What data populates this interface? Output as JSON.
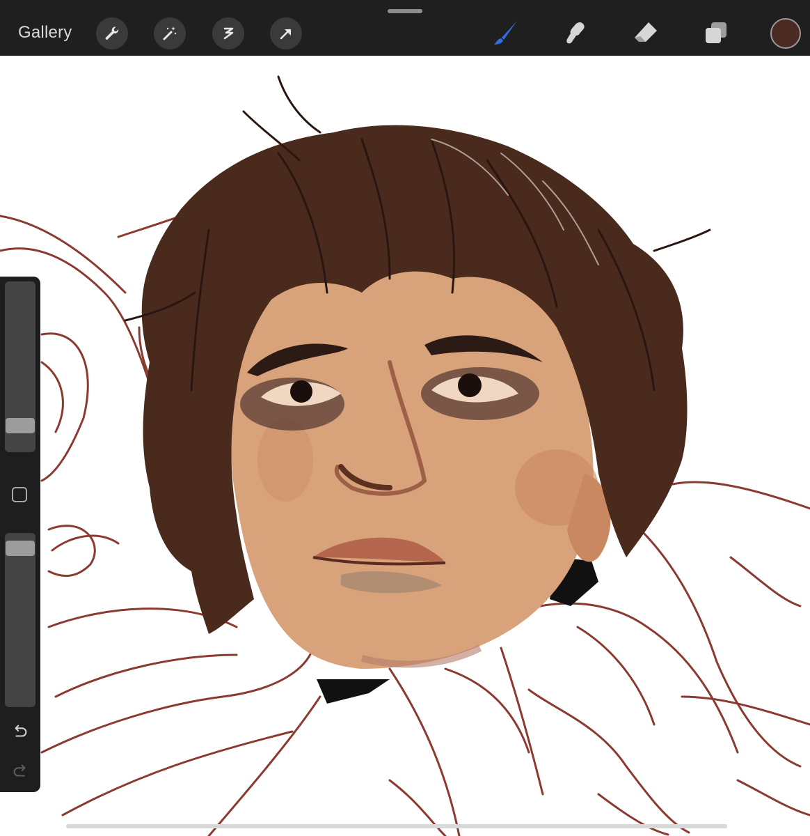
{
  "toolbar": {
    "gallery_label": "Gallery",
    "left_tools": [
      "wrench-icon",
      "magic-wand-icon",
      "selection-icon",
      "transform-arrow-icon"
    ],
    "right_tools": [
      "brush-icon",
      "smudge-icon",
      "eraser-icon",
      "layers-icon"
    ],
    "active_tool": "brush",
    "active_tool_color": "#2f6fe6",
    "current_color": "#4a2a22"
  },
  "sidebar": {
    "brush_size_level": 0.12,
    "opacity_level": 0.95,
    "modifier_icon": "modifier-square-icon",
    "undo_icon": "undo-icon",
    "redo_icon": "redo-icon"
  },
  "artwork": {
    "skin_color": "#d8a27a",
    "hair_color": "#4a2a1c",
    "sketch_color": "#8b3a32"
  }
}
